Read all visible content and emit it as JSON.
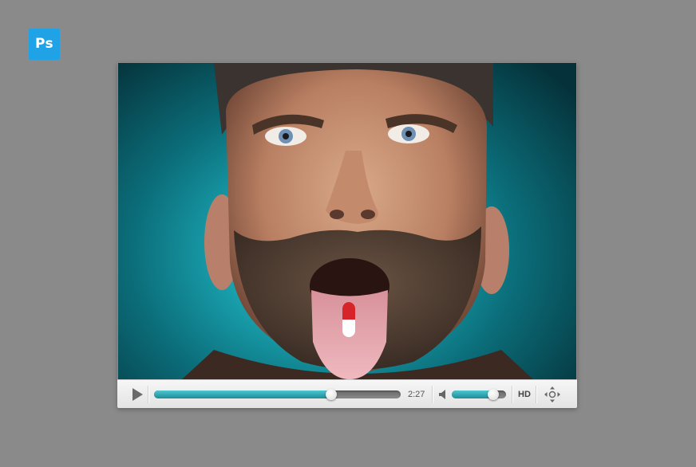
{
  "app_badge": {
    "label": "Ps",
    "color": "#1fa3e6"
  },
  "player": {
    "video": {
      "subject": "man-holding-pill-on-tongue"
    },
    "controls": {
      "play_icon": "play-icon",
      "progress": 0.72,
      "current_time": "2:27",
      "volume_icon": "speaker-icon",
      "volume": 0.77,
      "hd_label": "HD",
      "fullscreen_icon": "fullscreen-move-icon"
    },
    "colors": {
      "accent": "#2aa8b3",
      "track": "#777777"
    }
  }
}
